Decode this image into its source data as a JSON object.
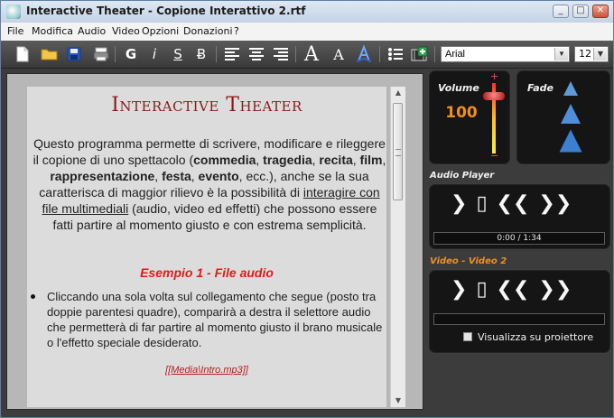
{
  "window": {
    "title": "Interactive Theater - Copione Interattivo 2.rtf",
    "minimize_glyph": "_",
    "maximize_glyph": "□",
    "close_glyph": "✕"
  },
  "menu": [
    "File",
    "Modifica",
    "Audio",
    "Video",
    "Opzioni",
    "Donazioni",
    "?"
  ],
  "toolbar": {
    "bold_label": "G",
    "italic_label": "i",
    "underline_label": "S",
    "strike_label": "Ƀ",
    "font_name": "Arial",
    "font_size": "12",
    "font_up_label": "A",
    "font_down_label": "A"
  },
  "document": {
    "title": "Interactive Theater",
    "intro_part1": "Questo programma permette di scrivere, modificare e rileggere il copione di uno spettacolo (",
    "intro_bold1": "commedia",
    "sep1": ", ",
    "intro_bold2": "tragedia",
    "sep2": ", ",
    "intro_bold3": "recita",
    "sep3": ", ",
    "intro_bold4": "film",
    "sep4": ", ",
    "intro_bold5": "rappresentazione",
    "sep5": ", ",
    "intro_bold6": "festa",
    "sep6": ", ",
    "intro_bold7": "evento",
    "intro_part2": ", ecc.), anche se la sua caratterisca di maggior rilievo è la possibilità di ",
    "intro_link": "interagire con file multimediali",
    "intro_part3": " (audio, video ed effetti) che possono essere fatti partire al momento giusto e con estrema semplicità.",
    "example_heading": "Esempio 1 - File audio",
    "bullet_text": "Cliccando una sola volta sul collegamento che segue (posto tra doppie parentesi quadre), comparirà a destra il selettore audio che permetterà di far partire al momento giusto il brano musicale o l'effetto speciale desiderato.",
    "media_link": "[[Media\\Intro.mp3]]"
  },
  "right_panel": {
    "volume_label": "Volume",
    "volume_value": "100",
    "volume_plus": "+",
    "volume_minus": "−",
    "volume_level": 1.0,
    "fade_label": "Fade",
    "audio_player_label": "Audio Player",
    "audio_time": "0:00 / 1:34",
    "video_label": "Video - Video 2",
    "projector_label": "Visualizza su proiettore",
    "play_glyph": "❯",
    "stop_glyph": "▯",
    "rewind_glyph": "❮❮",
    "forward_glyph": "❯❯",
    "colors": {
      "accent_orange": "#f08e22",
      "panel_bg": "#151515",
      "video_label": "#f08e22"
    }
  }
}
